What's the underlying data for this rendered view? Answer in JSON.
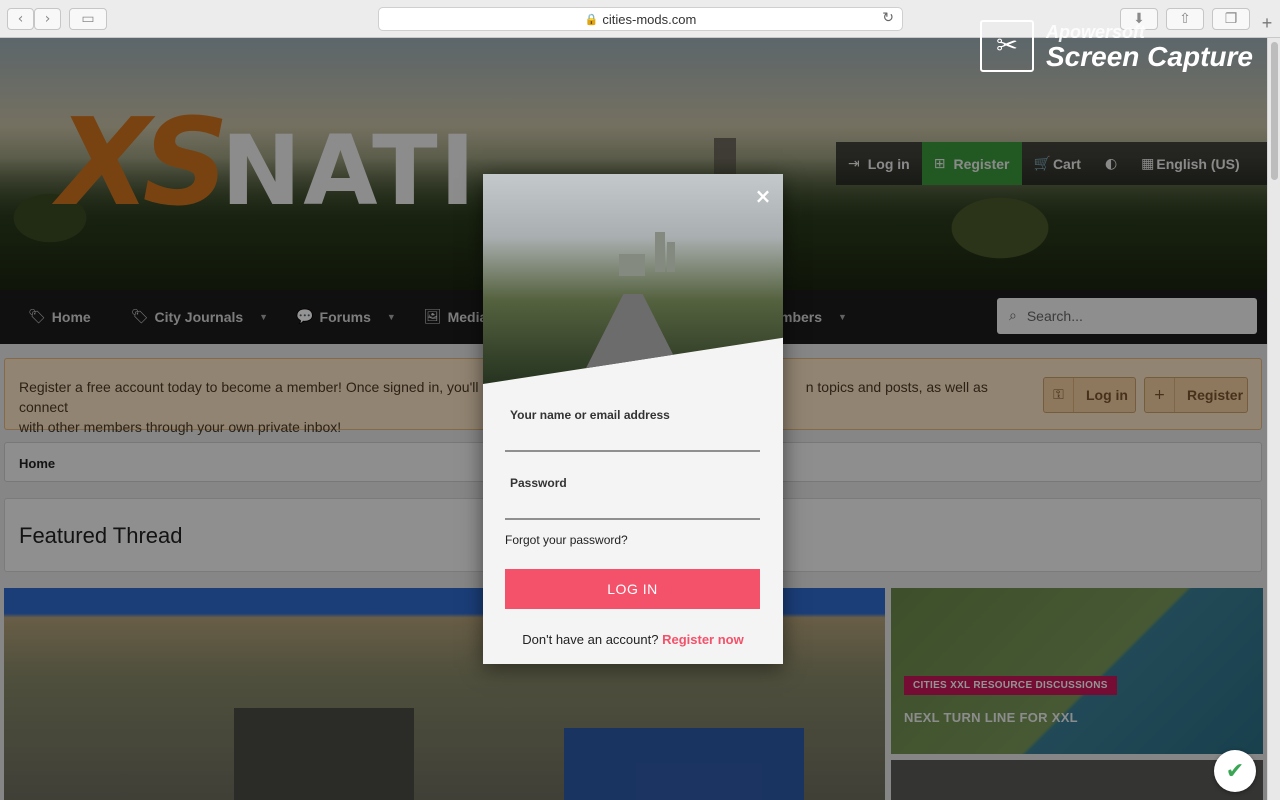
{
  "browser": {
    "url": "cities-mods.com",
    "back_icon": "‹",
    "forward_icon": "›",
    "sidebar_icon": "▭",
    "reload_icon": "↻",
    "download_icon": "⬇",
    "share_icon": "⇧",
    "tabs_icon": "❐",
    "newtab_icon": "+"
  },
  "watermark": {
    "line1": "Apowersoft",
    "line2": "Screen Capture"
  },
  "site": {
    "logo_xs": "XS",
    "logo_rest": "NATI"
  },
  "account_bar": {
    "login": "Log in",
    "register": "Register",
    "cart": "Cart",
    "language": "English (US)"
  },
  "nav": {
    "items": [
      {
        "label": "Home"
      },
      {
        "label": "City Journals"
      },
      {
        "label": "Forums"
      },
      {
        "label": "Media"
      },
      {
        "label": "mbers"
      }
    ],
    "search_placeholder": "Search..."
  },
  "notice": {
    "text_start": "Register a free account today to become a member! Once signed in, you'll be",
    "text_end": "n topics and posts, as well as connect",
    "text_line2": "with other members through your own private inbox!",
    "login": "Log in",
    "register": "Register"
  },
  "breadcrumb": {
    "home": "Home"
  },
  "featured": {
    "title": "Featured Thread"
  },
  "side_card": {
    "tag": "CITIES XXL RESOURCE DISCUSSIONS",
    "title": "NEXL TURN LINE FOR XXL"
  },
  "modal": {
    "close": "×",
    "name_label": "Your name or email address",
    "password_label": "Password",
    "forgot": "Forgot your password?",
    "login_button": "LOG IN",
    "no_account": "Don't have an account?",
    "register_now": "Register now"
  },
  "colors": {
    "accent": "#f4516a",
    "register_green": "#3c9a3c",
    "logo_orange": "#d0741e",
    "tag_pink": "#c8155a"
  }
}
